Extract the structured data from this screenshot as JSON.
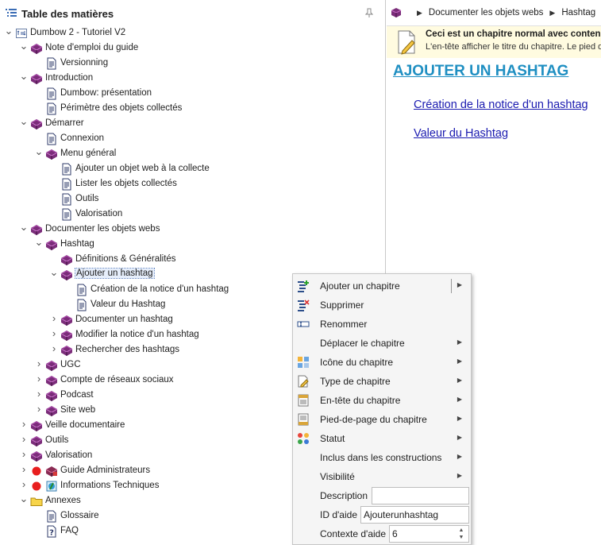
{
  "toc": {
    "title": "Table des matières",
    "items": [
      {
        "label": "Dumbow 2 - Tutoriel V2",
        "level": 0,
        "expander": "open",
        "icon": "project"
      },
      {
        "label": "Note d'emploi du guide",
        "level": 1,
        "expander": "open",
        "icon": "book"
      },
      {
        "label": "Versionning",
        "level": 2,
        "expander": "none",
        "icon": "page"
      },
      {
        "label": "Introduction",
        "level": 1,
        "expander": "open",
        "icon": "book"
      },
      {
        "label": "Dumbow: présentation",
        "level": 2,
        "expander": "none",
        "icon": "page"
      },
      {
        "label": "Périmètre des objets collectés",
        "level": 2,
        "expander": "none",
        "icon": "page"
      },
      {
        "label": "Démarrer",
        "level": 1,
        "expander": "open",
        "icon": "book"
      },
      {
        "label": "Connexion",
        "level": 2,
        "expander": "none",
        "icon": "page"
      },
      {
        "label": "Menu général",
        "level": 2,
        "expander": "open",
        "icon": "book"
      },
      {
        "label": "Ajouter un objet web à la collecte",
        "level": 3,
        "expander": "none",
        "icon": "page"
      },
      {
        "label": "Lister les objets collectés",
        "level": 3,
        "expander": "none",
        "icon": "page"
      },
      {
        "label": "Outils",
        "level": 3,
        "expander": "none",
        "icon": "page"
      },
      {
        "label": "Valorisation",
        "level": 3,
        "expander": "none",
        "icon": "page"
      },
      {
        "label": "Documenter les objets webs",
        "level": 1,
        "expander": "open",
        "icon": "book"
      },
      {
        "label": "Hashtag",
        "level": 2,
        "expander": "open",
        "icon": "book"
      },
      {
        "label": "Définitions & Généralités",
        "level": 3,
        "expander": "none",
        "icon": "book"
      },
      {
        "label": "Ajouter un hashtag",
        "level": 3,
        "expander": "open",
        "icon": "book",
        "selected": true
      },
      {
        "label": "Création de la notice d'un hashtag",
        "level": 4,
        "expander": "none",
        "icon": "page"
      },
      {
        "label": "Valeur du Hashtag",
        "level": 4,
        "expander": "none",
        "icon": "page"
      },
      {
        "label": "Documenter un hashtag",
        "level": 3,
        "expander": "closed",
        "icon": "book"
      },
      {
        "label": "Modifier la notice d'un hashtag",
        "level": 3,
        "expander": "closed",
        "icon": "book"
      },
      {
        "label": "Rechercher des hashtags",
        "level": 3,
        "expander": "closed",
        "icon": "book"
      },
      {
        "label": "UGC",
        "level": 2,
        "expander": "closed",
        "icon": "book"
      },
      {
        "label": "Compte de réseaux sociaux",
        "level": 2,
        "expander": "closed",
        "icon": "book"
      },
      {
        "label": "Podcast",
        "level": 2,
        "expander": "closed",
        "icon": "book"
      },
      {
        "label": "Site web",
        "level": 2,
        "expander": "closed",
        "icon": "book"
      },
      {
        "label": "Veille documentaire",
        "level": 1,
        "expander": "closed",
        "icon": "book"
      },
      {
        "label": "Outils",
        "level": 1,
        "expander": "closed",
        "icon": "book"
      },
      {
        "label": "Valorisation",
        "level": 1,
        "expander": "closed",
        "icon": "book"
      },
      {
        "label": "Guide Administrateurs",
        "level": 1,
        "expander": "closed",
        "icon": "book-red",
        "status": "red"
      },
      {
        "label": "Informations Techniques",
        "level": 1,
        "expander": "closed",
        "icon": "info",
        "status": "red"
      },
      {
        "label": "Annexes",
        "level": 1,
        "expander": "open",
        "icon": "folder"
      },
      {
        "label": "Glossaire",
        "level": 2,
        "expander": "none",
        "icon": "page"
      },
      {
        "label": "FAQ",
        "level": 2,
        "expander": "none",
        "icon": "help"
      }
    ]
  },
  "content": {
    "breadcrumb": [
      "Documenter les objets webs",
      "Hashtag"
    ],
    "notice_head": "Ceci est un chapitre normal avec contenu",
    "notice_sub": "L'en-tête afficher le titre du chapitre.   Le pied de page",
    "title": "AJOUTER UN HASHTAG",
    "links": [
      "Création de la notice d'un hashtag",
      "Valeur du Hashtag"
    ]
  },
  "context_menu": {
    "items": [
      {
        "label": "Ajouter un chapitre",
        "icon": "add-chapter",
        "submenu": true,
        "split": true
      },
      {
        "label": "Supprimer",
        "icon": "delete-chapter",
        "submenu": false
      },
      {
        "label": "Renommer",
        "icon": "rename",
        "submenu": false
      },
      {
        "label": "Déplacer le chapitre",
        "icon": "",
        "submenu": true
      },
      {
        "label": "Icône du chapitre",
        "icon": "grid",
        "submenu": true
      },
      {
        "label": "Type de chapitre",
        "icon": "pencil-page",
        "submenu": true
      },
      {
        "label": "En-tête du chapitre",
        "icon": "header",
        "submenu": true
      },
      {
        "label": "Pied-de-page du chapitre",
        "icon": "footer",
        "submenu": true
      },
      {
        "label": "Statut",
        "icon": "status-dots",
        "submenu": true
      },
      {
        "label": "Inclus dans les constructions",
        "icon": "",
        "submenu": true
      },
      {
        "label": "Visibilité",
        "icon": "",
        "submenu": true
      }
    ],
    "description_label": "Description",
    "description_value": "",
    "help_id_label": "ID d'aide",
    "help_id_value": "Ajouterunhashtag",
    "help_context_label": "Contexte d'aide",
    "help_context_value": "6"
  }
}
